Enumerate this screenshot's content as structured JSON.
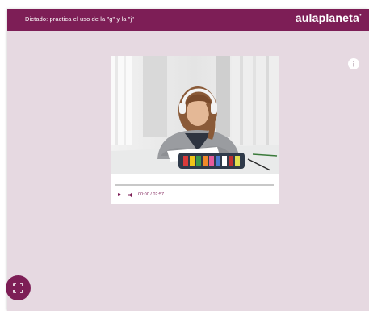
{
  "header": {
    "title": "Dictado: practica el uso de la \"g\" y la \"j\"",
    "logo": "aulaplaneta"
  },
  "media": {
    "image_icon": "photo-girl-writing-with-headphones",
    "audio": {
      "time": "00:00 / 02:57",
      "progress": 0,
      "play_icon": "play-icon",
      "volume_icon": "volume-icon"
    }
  },
  "controls": {
    "info_icon": "info-icon",
    "fullscreen_icon": "fullscreen-icon"
  },
  "colors": {
    "brand": "#7d1e56",
    "background": "#e6d9e1"
  }
}
